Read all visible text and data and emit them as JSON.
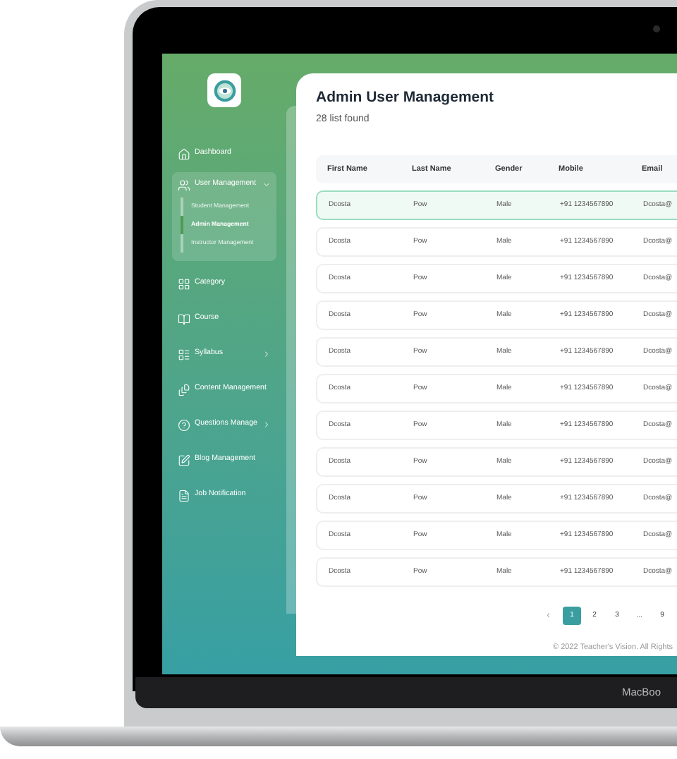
{
  "device": {
    "label": "MacBoo"
  },
  "sidebar": {
    "items": [
      {
        "kind": "link",
        "label": "Dashboard",
        "selected": false
      },
      {
        "kind": "group",
        "label": "User Management",
        "selected": true,
        "expanded": true,
        "children": [
          {
            "label": "Student Management",
            "selected": false
          },
          {
            "label": "Admin Management",
            "selected": true
          },
          {
            "label": "Instructor Management",
            "selected": false
          }
        ]
      },
      {
        "kind": "link",
        "label": "Category",
        "selected": false
      },
      {
        "kind": "link",
        "label": "Course",
        "selected": false
      },
      {
        "kind": "group",
        "label": "Syllabus",
        "selected": false,
        "expanded": false
      },
      {
        "kind": "link",
        "label": "Content Management",
        "selected": false
      },
      {
        "kind": "group",
        "label": "Questions Manage",
        "selected": false,
        "expanded": false
      },
      {
        "kind": "link",
        "label": "Blog Management",
        "selected": false
      },
      {
        "kind": "link",
        "label": "Job Notification",
        "selected": false
      }
    ]
  },
  "page": {
    "title": "Admin User Management",
    "subtitle": "28 list found"
  },
  "table": {
    "columns": [
      "First Name",
      "Last Name",
      "Gender",
      "Mobile",
      "Email"
    ],
    "rows": [
      {
        "cells": [
          "Dcosta",
          "Pow",
          "Male",
          "+91 1234567890",
          "Dcosta@"
        ],
        "selected": true
      },
      {
        "cells": [
          "Dcosta",
          "Pow",
          "Male",
          "+91 1234567890",
          "Dcosta@"
        ],
        "selected": false
      },
      {
        "cells": [
          "Dcosta",
          "Pow",
          "Male",
          "+91 1234567890",
          "Dcosta@"
        ],
        "selected": false
      },
      {
        "cells": [
          "Dcosta",
          "Pow",
          "Male",
          "+91 1234567890",
          "Dcosta@"
        ],
        "selected": false
      },
      {
        "cells": [
          "Dcosta",
          "Pow",
          "Male",
          "+91 1234567890",
          "Dcosta@"
        ],
        "selected": false
      },
      {
        "cells": [
          "Dcosta",
          "Pow",
          "Male",
          "+91 1234567890",
          "Dcosta@"
        ],
        "selected": false
      },
      {
        "cells": [
          "Dcosta",
          "Pow",
          "Male",
          "+91 1234567890",
          "Dcosta@"
        ],
        "selected": false
      },
      {
        "cells": [
          "Dcosta",
          "Pow",
          "Male",
          "+91 1234567890",
          "Dcosta@"
        ],
        "selected": false
      },
      {
        "cells": [
          "Dcosta",
          "Pow",
          "Male",
          "+91 1234567890",
          "Dcosta@"
        ],
        "selected": false
      },
      {
        "cells": [
          "Dcosta",
          "Pow",
          "Male",
          "+91 1234567890",
          "Dcosta@"
        ],
        "selected": false
      },
      {
        "cells": [
          "Dcosta",
          "Pow",
          "Male",
          "+91 1234567890",
          "Dcosta@"
        ],
        "selected": false
      }
    ]
  },
  "pagination": {
    "previous": "‹",
    "pages": [
      {
        "label": "1",
        "selected": true
      },
      {
        "label": "2",
        "selected": false
      },
      {
        "label": "3",
        "selected": false
      },
      {
        "label": "...",
        "selected": false
      },
      {
        "label": "9",
        "selected": false
      }
    ]
  },
  "footer": "© 2022 Teacher's Vision. All Rights"
}
